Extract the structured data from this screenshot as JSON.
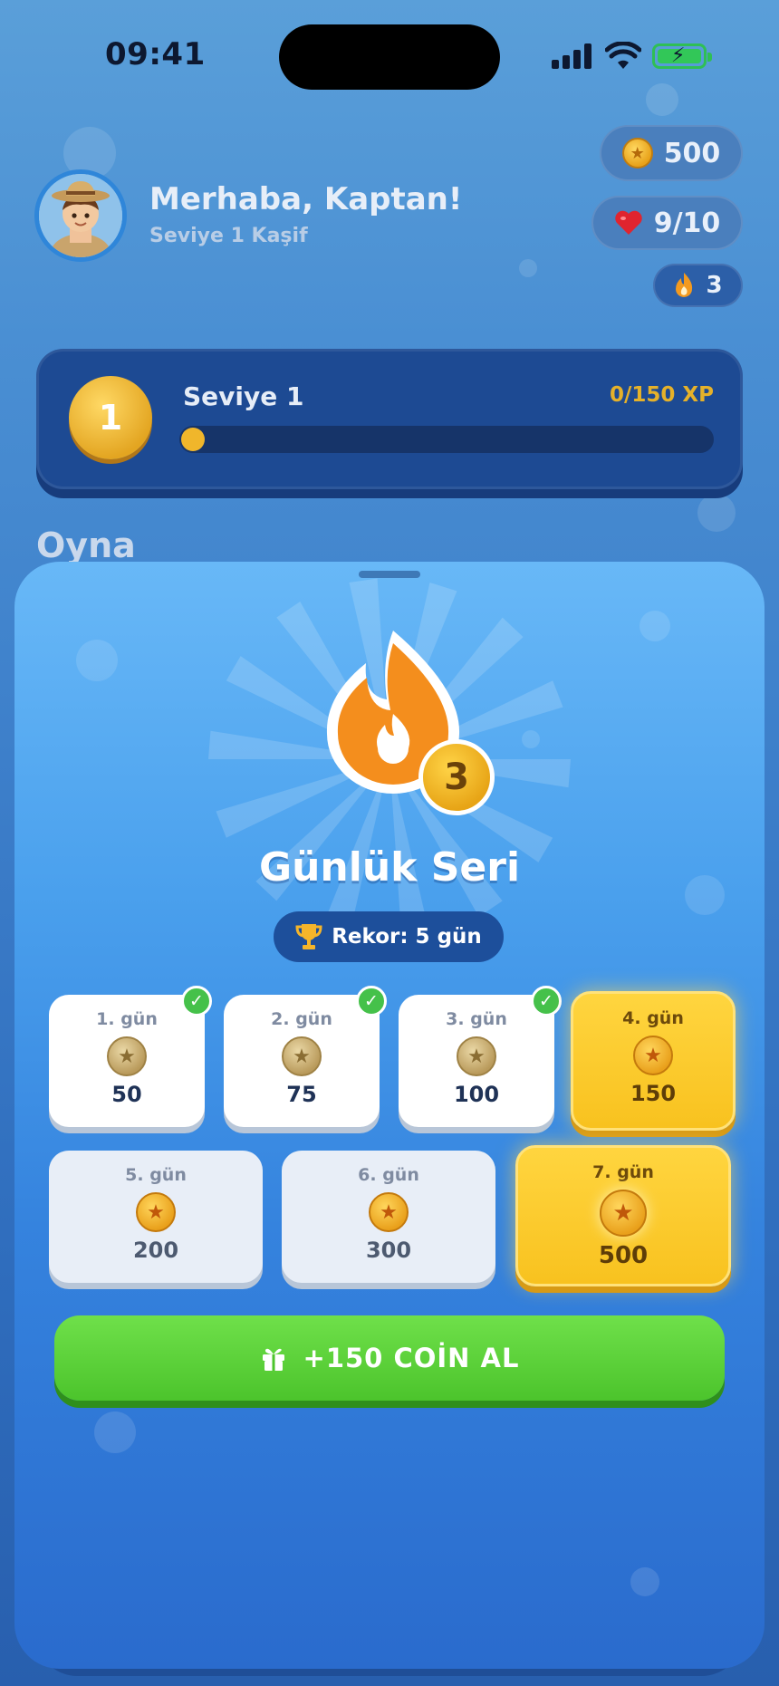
{
  "status_bar": {
    "time": "09:41"
  },
  "header": {
    "greeting": "Merhaba, Kaptan!",
    "subtitle": "Seviye 1 Kaşif",
    "coins": "500",
    "lives": "9/10",
    "streak": "3"
  },
  "level_card": {
    "badge": "1",
    "title": "Seviye 1",
    "xp_text": "0/150 XP",
    "xp_progress": 0
  },
  "section": {
    "title": "Oyna"
  },
  "streak_modal": {
    "streak_count": "3",
    "title": "Günlük Seri",
    "record": "Rekor: 5 gün",
    "days": [
      {
        "label": "1. gün",
        "reward": "50",
        "state": "claimed"
      },
      {
        "label": "2. gün",
        "reward": "75",
        "state": "claimed"
      },
      {
        "label": "3. gün",
        "reward": "100",
        "state": "claimed"
      },
      {
        "label": "4. gün",
        "reward": "150",
        "state": "today"
      },
      {
        "label": "5. gün",
        "reward": "200",
        "state": "future"
      },
      {
        "label": "6. gün",
        "reward": "300",
        "state": "future"
      },
      {
        "label": "7. gün",
        "reward": "500",
        "state": "bonus"
      }
    ],
    "claim_button": "+150 COİN AL"
  },
  "colors": {
    "accent_green": "#4cc42c",
    "gold": "#f8c21f",
    "navy": "#1d4a93",
    "flame": "#f08a1c"
  },
  "icons": {
    "coin": "coin-icon",
    "heart": "heart-icon",
    "flame": "flame-icon",
    "trophy": "trophy-icon",
    "gift": "gift-icon",
    "check": "check-icon"
  }
}
